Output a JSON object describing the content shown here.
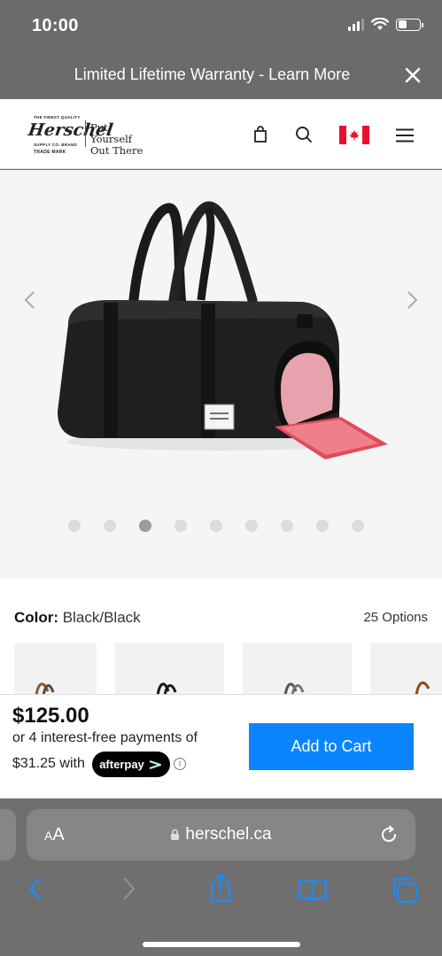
{
  "status_bar": {
    "time": "10:00"
  },
  "banner": {
    "text": "Limited Lifetime Warranty - Learn More",
    "close_icon": "close-icon"
  },
  "header": {
    "logo": {
      "brand": "Herschel",
      "small_top": "THE FINEST QUALITY",
      "small_mid": "SUPPLY CO. BRAND",
      "small_bottom": "TRADE MARK",
      "tagline": "Put Yourself\nOut There"
    },
    "icons": [
      "bag-icon",
      "search-icon",
      "canada-flag-icon",
      "menu-icon"
    ]
  },
  "gallery": {
    "image": "black-duffle-bag",
    "total_images": 9,
    "active_index": 2
  },
  "color": {
    "label": "Color:",
    "value": "Black/Black",
    "options": "25 Options"
  },
  "purchase": {
    "price": "$125.00",
    "installments_text": "or 4 interest-free payments of",
    "installment_amount": "$31.25 with",
    "afterpay_label": "afterpay",
    "info_symbol": "i",
    "add_to_cart": "Add to Cart"
  },
  "safari": {
    "aa_small": "A",
    "aa_large": "A",
    "url": "herschel.ca"
  },
  "colors": {
    "accent": "#0a84ff",
    "banner_bg": "#6b6b6b",
    "gallery_bg": "#f5f5f5",
    "afterpay_bg": "#000000"
  }
}
